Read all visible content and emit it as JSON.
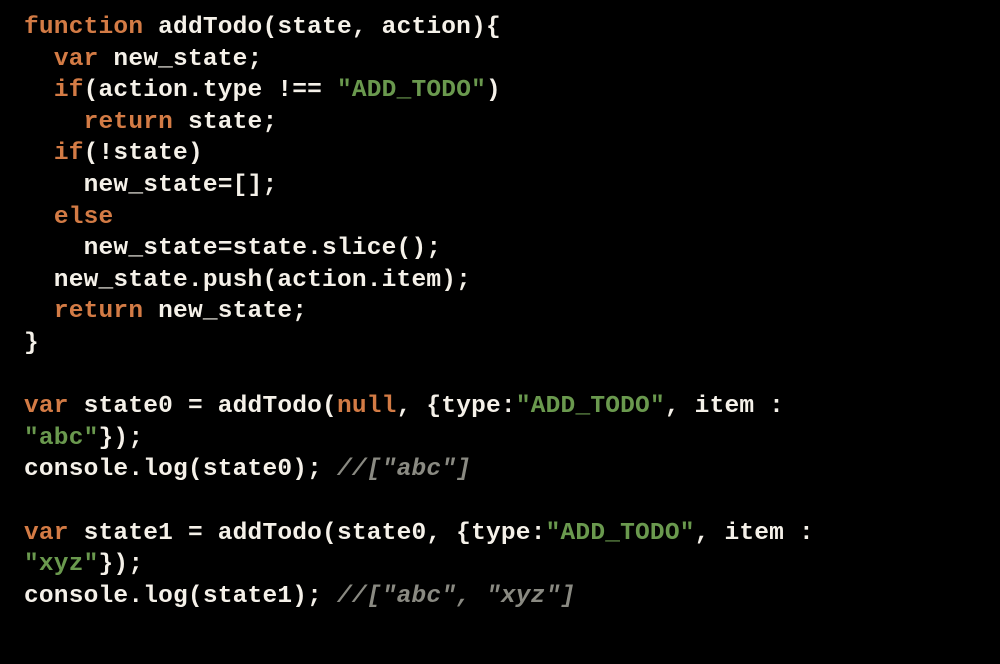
{
  "code": {
    "lines": [
      {
        "tokens": [
          {
            "cls": "kw",
            "t": "function"
          },
          {
            "cls": "pln",
            "t": " addTodo(state, action){"
          }
        ]
      },
      {
        "tokens": [
          {
            "cls": "pln",
            "t": "  "
          },
          {
            "cls": "kw",
            "t": "var"
          },
          {
            "cls": "pln",
            "t": " new_state;"
          }
        ]
      },
      {
        "tokens": [
          {
            "cls": "pln",
            "t": "  "
          },
          {
            "cls": "kw",
            "t": "if"
          },
          {
            "cls": "pln",
            "t": "(action.type !== "
          },
          {
            "cls": "str",
            "t": "\"ADD_TODO\""
          },
          {
            "cls": "pln",
            "t": ")"
          }
        ]
      },
      {
        "tokens": [
          {
            "cls": "pln",
            "t": "    "
          },
          {
            "cls": "kw",
            "t": "return"
          },
          {
            "cls": "pln",
            "t": " state;"
          }
        ]
      },
      {
        "tokens": [
          {
            "cls": "pln",
            "t": "  "
          },
          {
            "cls": "kw",
            "t": "if"
          },
          {
            "cls": "pln",
            "t": "(!state)"
          }
        ]
      },
      {
        "tokens": [
          {
            "cls": "pln",
            "t": "    new_state=[];"
          }
        ]
      },
      {
        "tokens": [
          {
            "cls": "pln",
            "t": "  "
          },
          {
            "cls": "kw",
            "t": "else"
          }
        ]
      },
      {
        "tokens": [
          {
            "cls": "pln",
            "t": "    new_state=state.slice();"
          }
        ]
      },
      {
        "tokens": [
          {
            "cls": "pln",
            "t": "  new_state.push(action.item);"
          }
        ]
      },
      {
        "tokens": [
          {
            "cls": "pln",
            "t": "  "
          },
          {
            "cls": "kw",
            "t": "return"
          },
          {
            "cls": "pln",
            "t": " new_state;"
          }
        ]
      },
      {
        "tokens": [
          {
            "cls": "pln",
            "t": "}"
          }
        ]
      },
      {
        "tokens": [
          {
            "cls": "pln",
            "t": ""
          }
        ]
      },
      {
        "tokens": [
          {
            "cls": "kw",
            "t": "var"
          },
          {
            "cls": "pln",
            "t": " state0 = addTodo("
          },
          {
            "cls": "kw",
            "t": "null"
          },
          {
            "cls": "pln",
            "t": ", {type:"
          },
          {
            "cls": "str",
            "t": "\"ADD_TODO\""
          },
          {
            "cls": "pln",
            "t": ", item : "
          }
        ]
      },
      {
        "tokens": [
          {
            "cls": "str",
            "t": "\"abc\""
          },
          {
            "cls": "pln",
            "t": "});"
          }
        ]
      },
      {
        "tokens": [
          {
            "cls": "pln",
            "t": "console.log(state0); "
          },
          {
            "cls": "cmt",
            "t": "//[\"abc\"]"
          }
        ]
      },
      {
        "tokens": [
          {
            "cls": "pln",
            "t": ""
          }
        ]
      },
      {
        "tokens": [
          {
            "cls": "kw",
            "t": "var"
          },
          {
            "cls": "pln",
            "t": " state1 = addTodo(state0, {type:"
          },
          {
            "cls": "str",
            "t": "\"ADD_TODO\""
          },
          {
            "cls": "pln",
            "t": ", item : "
          }
        ]
      },
      {
        "tokens": [
          {
            "cls": "str",
            "t": "\"xyz\""
          },
          {
            "cls": "pln",
            "t": "});"
          }
        ]
      },
      {
        "tokens": [
          {
            "cls": "pln",
            "t": "console.log(state1); "
          },
          {
            "cls": "cmt",
            "t": "//[\"abc\", \"xyz\"]"
          }
        ]
      }
    ]
  }
}
